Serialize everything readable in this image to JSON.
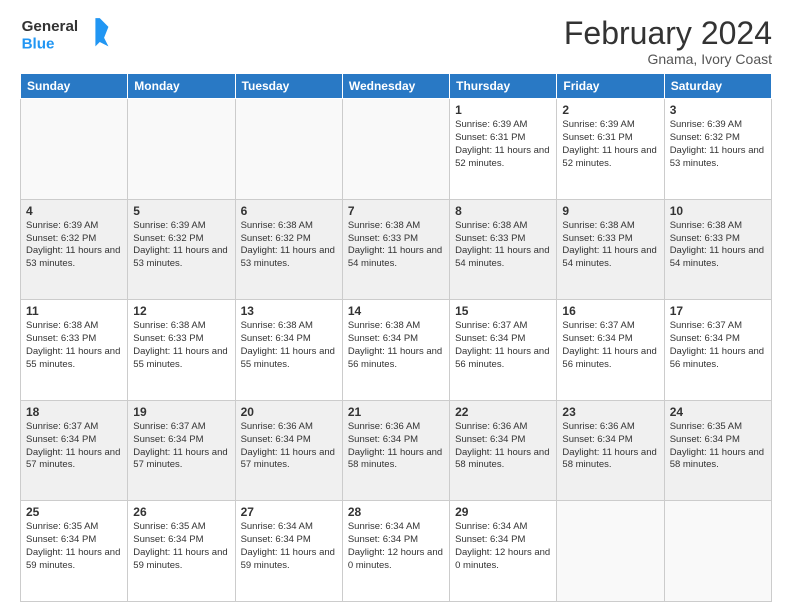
{
  "logo": {
    "line1": "General",
    "line2": "Blue"
  },
  "header": {
    "title": "February 2024",
    "subtitle": "Gnama, Ivory Coast"
  },
  "weekdays": [
    "Sunday",
    "Monday",
    "Tuesday",
    "Wednesday",
    "Thursday",
    "Friday",
    "Saturday"
  ],
  "rows": [
    {
      "cells": [
        {
          "empty": true
        },
        {
          "empty": true
        },
        {
          "empty": true
        },
        {
          "empty": true
        },
        {
          "day": "1",
          "sunrise": "6:39 AM",
          "sunset": "6:31 PM",
          "daylight": "11 hours and 52 minutes."
        },
        {
          "day": "2",
          "sunrise": "6:39 AM",
          "sunset": "6:31 PM",
          "daylight": "11 hours and 52 minutes."
        },
        {
          "day": "3",
          "sunrise": "6:39 AM",
          "sunset": "6:32 PM",
          "daylight": "11 hours and 53 minutes."
        }
      ]
    },
    {
      "cells": [
        {
          "day": "4",
          "sunrise": "6:39 AM",
          "sunset": "6:32 PM",
          "daylight": "11 hours and 53 minutes."
        },
        {
          "day": "5",
          "sunrise": "6:39 AM",
          "sunset": "6:32 PM",
          "daylight": "11 hours and 53 minutes."
        },
        {
          "day": "6",
          "sunrise": "6:38 AM",
          "sunset": "6:32 PM",
          "daylight": "11 hours and 53 minutes."
        },
        {
          "day": "7",
          "sunrise": "6:38 AM",
          "sunset": "6:33 PM",
          "daylight": "11 hours and 54 minutes."
        },
        {
          "day": "8",
          "sunrise": "6:38 AM",
          "sunset": "6:33 PM",
          "daylight": "11 hours and 54 minutes."
        },
        {
          "day": "9",
          "sunrise": "6:38 AM",
          "sunset": "6:33 PM",
          "daylight": "11 hours and 54 minutes."
        },
        {
          "day": "10",
          "sunrise": "6:38 AM",
          "sunset": "6:33 PM",
          "daylight": "11 hours and 54 minutes."
        }
      ]
    },
    {
      "cells": [
        {
          "day": "11",
          "sunrise": "6:38 AM",
          "sunset": "6:33 PM",
          "daylight": "11 hours and 55 minutes."
        },
        {
          "day": "12",
          "sunrise": "6:38 AM",
          "sunset": "6:33 PM",
          "daylight": "11 hours and 55 minutes."
        },
        {
          "day": "13",
          "sunrise": "6:38 AM",
          "sunset": "6:34 PM",
          "daylight": "11 hours and 55 minutes."
        },
        {
          "day": "14",
          "sunrise": "6:38 AM",
          "sunset": "6:34 PM",
          "daylight": "11 hours and 56 minutes."
        },
        {
          "day": "15",
          "sunrise": "6:37 AM",
          "sunset": "6:34 PM",
          "daylight": "11 hours and 56 minutes."
        },
        {
          "day": "16",
          "sunrise": "6:37 AM",
          "sunset": "6:34 PM",
          "daylight": "11 hours and 56 minutes."
        },
        {
          "day": "17",
          "sunrise": "6:37 AM",
          "sunset": "6:34 PM",
          "daylight": "11 hours and 56 minutes."
        }
      ]
    },
    {
      "cells": [
        {
          "day": "18",
          "sunrise": "6:37 AM",
          "sunset": "6:34 PM",
          "daylight": "11 hours and 57 minutes."
        },
        {
          "day": "19",
          "sunrise": "6:37 AM",
          "sunset": "6:34 PM",
          "daylight": "11 hours and 57 minutes."
        },
        {
          "day": "20",
          "sunrise": "6:36 AM",
          "sunset": "6:34 PM",
          "daylight": "11 hours and 57 minutes."
        },
        {
          "day": "21",
          "sunrise": "6:36 AM",
          "sunset": "6:34 PM",
          "daylight": "11 hours and 58 minutes."
        },
        {
          "day": "22",
          "sunrise": "6:36 AM",
          "sunset": "6:34 PM",
          "daylight": "11 hours and 58 minutes."
        },
        {
          "day": "23",
          "sunrise": "6:36 AM",
          "sunset": "6:34 PM",
          "daylight": "11 hours and 58 minutes."
        },
        {
          "day": "24",
          "sunrise": "6:35 AM",
          "sunset": "6:34 PM",
          "daylight": "11 hours and 58 minutes."
        }
      ]
    },
    {
      "cells": [
        {
          "day": "25",
          "sunrise": "6:35 AM",
          "sunset": "6:34 PM",
          "daylight": "11 hours and 59 minutes."
        },
        {
          "day": "26",
          "sunrise": "6:35 AM",
          "sunset": "6:34 PM",
          "daylight": "11 hours and 59 minutes."
        },
        {
          "day": "27",
          "sunrise": "6:34 AM",
          "sunset": "6:34 PM",
          "daylight": "11 hours and 59 minutes."
        },
        {
          "day": "28",
          "sunrise": "6:34 AM",
          "sunset": "6:34 PM",
          "daylight": "12 hours and 0 minutes."
        },
        {
          "day": "29",
          "sunrise": "6:34 AM",
          "sunset": "6:34 PM",
          "daylight": "12 hours and 0 minutes."
        },
        {
          "empty": true
        },
        {
          "empty": true
        }
      ]
    }
  ]
}
